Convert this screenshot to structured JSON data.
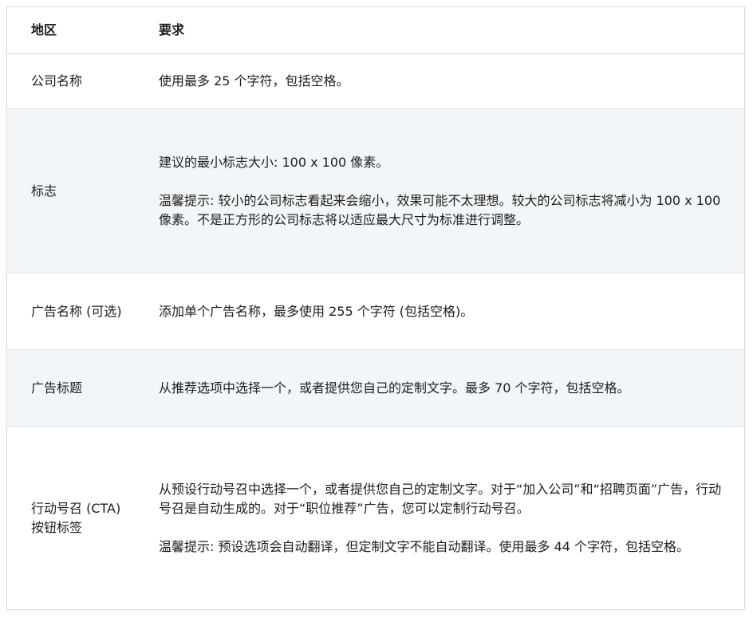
{
  "table": {
    "headers": {
      "region": "地区",
      "requirement": "要求"
    },
    "rows": [
      {
        "region": "公司名称",
        "paragraphs": [
          "使用最多 25 个字符，包括空格。"
        ]
      },
      {
        "region": "标志",
        "paragraphs": [
          "建议的最小标志大小: 100 x 100 像素。",
          "温馨提示: 较小的公司标志看起来会缩小，效果可能不太理想。较大的公司标志将减小为 100 x 100 像素。不是正方形的公司标志将以适应最大尺寸为标准进行调整。"
        ]
      },
      {
        "region": "广告名称 (可选)",
        "paragraphs": [
          "添加单个广告名称，最多使用 255 个字符 (包括空格)。"
        ]
      },
      {
        "region": "广告标题",
        "paragraphs": [
          "从推荐选项中选择一个，或者提供您自己的定制文字。最多 70 个字符，包括空格。"
        ]
      },
      {
        "region": "行动号召 (CTA) 按钮标签",
        "paragraphs": [
          "从预设行动号召中选择一个，或者提供您自己的定制文字。对于“加入公司”和“招聘页面”广告，行动号召是自动生成的。对于“职位推荐”广告，您可以定制行动号召。",
          "温馨提示: 预设选项会自动翻译，但定制文字不能自动翻译。使用最多 44 个字符，包括空格。"
        ]
      }
    ]
  }
}
